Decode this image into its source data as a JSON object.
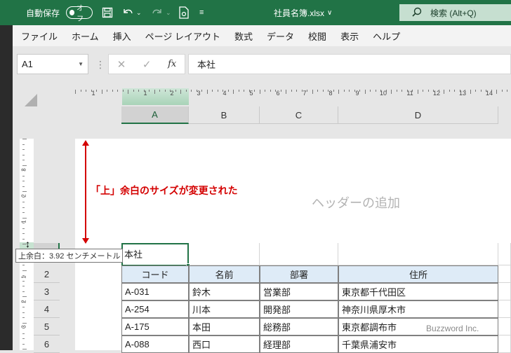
{
  "titlebar": {
    "autosave_label": "自動保存",
    "autosave_toggle": "オフ",
    "doc_title": "社員名簿.xlsx",
    "search_placeholder": "検索 (Alt+Q)"
  },
  "menu": [
    "ファイル",
    "ホーム",
    "挿入",
    "ページ レイアウト",
    "数式",
    "データ",
    "校閲",
    "表示",
    "ヘルプ"
  ],
  "formula_bar": {
    "name_box": "A1",
    "formula_value": "本社",
    "fx_label": "fx"
  },
  "ruler": {
    "h_numbers": [
      "1",
      "1",
      "2",
      "3",
      "4",
      "5",
      "6",
      "7",
      "8",
      "9",
      "10",
      "11",
      "12",
      "13",
      "14"
    ],
    "v_numbers": [
      "3",
      "2",
      "1",
      "1",
      "2",
      "3"
    ]
  },
  "columns": [
    "A",
    "B",
    "C",
    "D"
  ],
  "page": {
    "annotation": "「上」余白のサイズが変更された",
    "header_placeholder": "ヘッダーの追加",
    "margin_tooltip": "上余白：3.92 センチメートル"
  },
  "rows": [
    "2",
    "3",
    "4",
    "5",
    "6"
  ],
  "cells": {
    "a1": "本社",
    "headers": [
      "コード",
      "名前",
      "部署",
      "住所"
    ],
    "data": [
      [
        "A-031",
        "鈴木",
        "営業部",
        "東京都千代田区"
      ],
      [
        "A-254",
        "川本",
        "開発部",
        "神奈川県厚木市"
      ],
      [
        "A-175",
        "本田",
        "総務部",
        "東京都調布市"
      ],
      [
        "A-088",
        "西口",
        "経理部",
        "千葉県浦安市"
      ]
    ]
  },
  "watermark": "Buzzword Inc.",
  "colors": {
    "title_bg": "#217346",
    "annotation": "#d40000",
    "header_fill": "#deebf7"
  }
}
